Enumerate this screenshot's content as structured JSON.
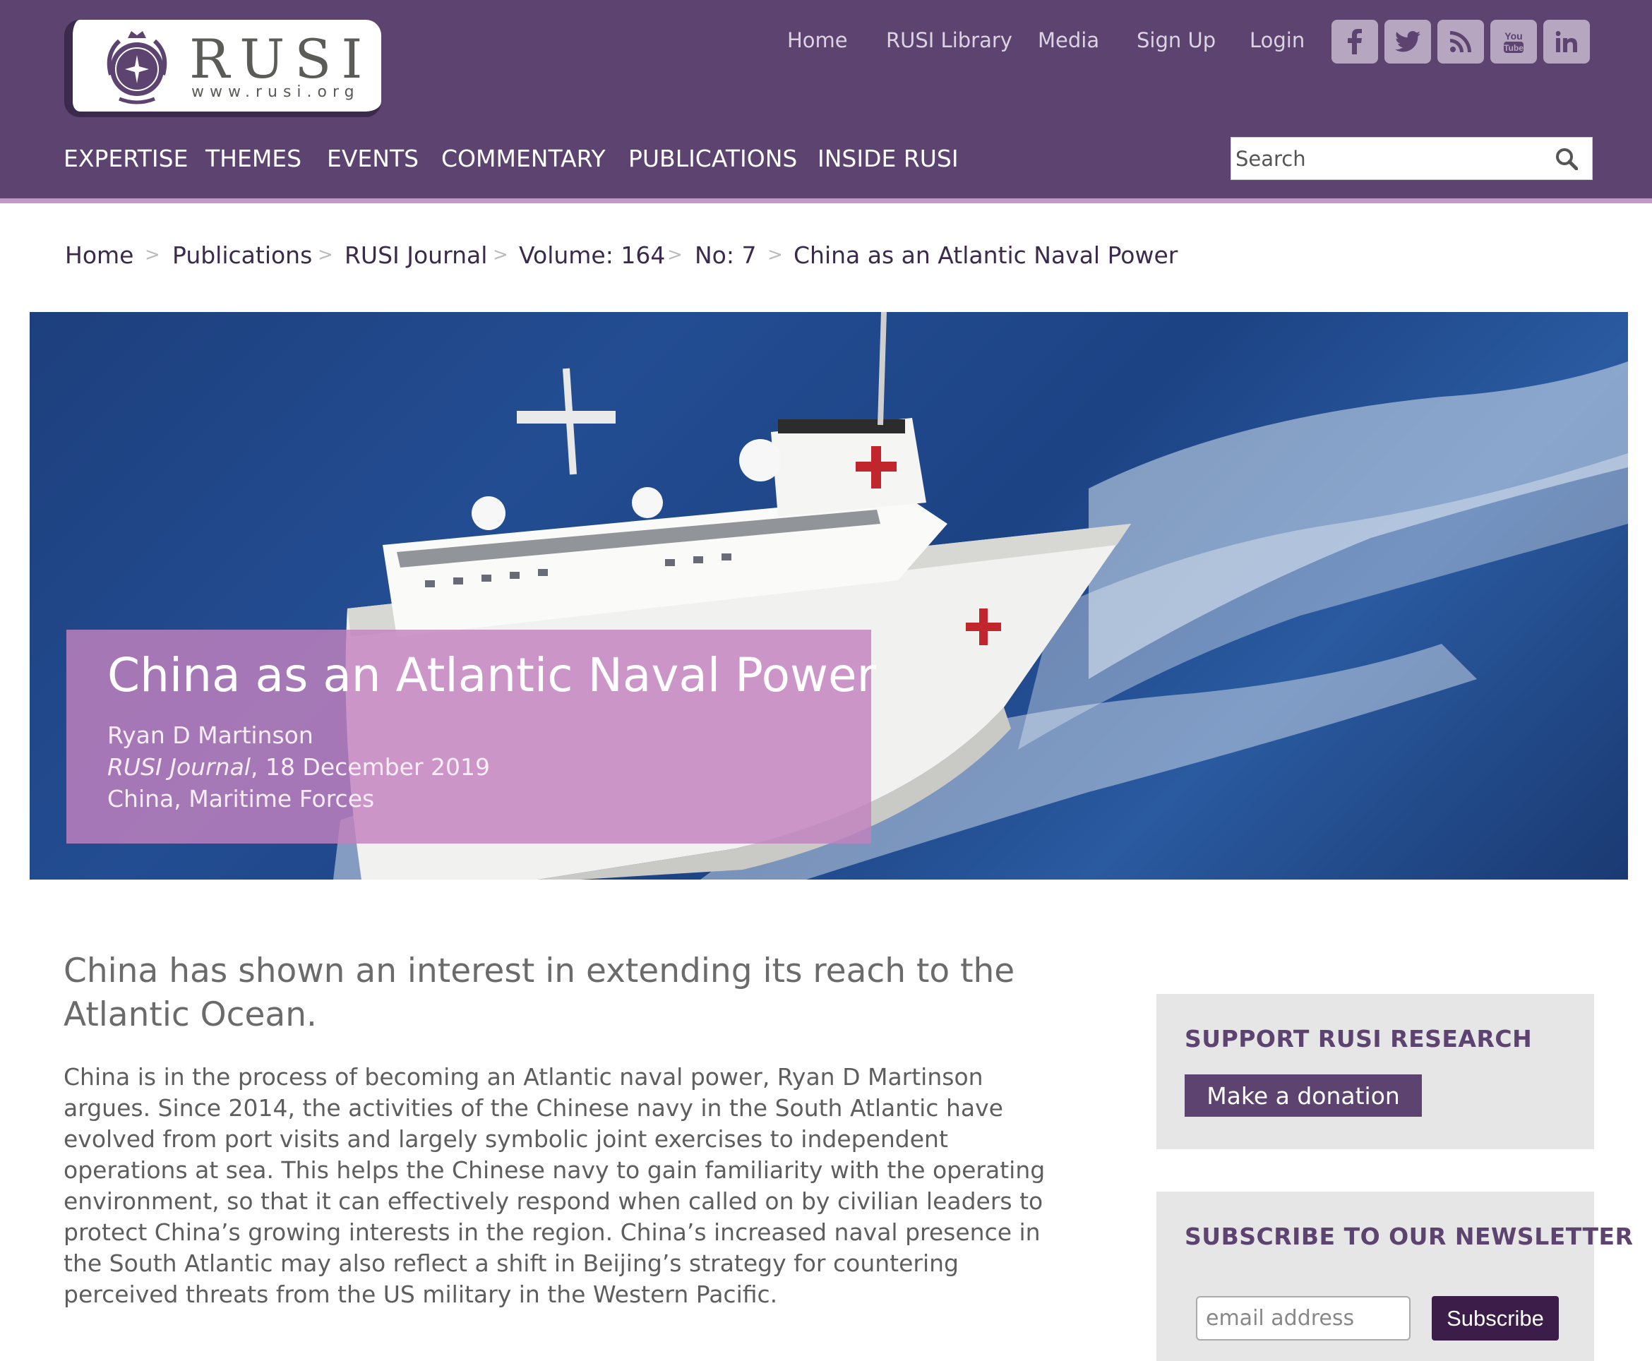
{
  "logo": {
    "name": "RUSI",
    "url": "www.rusi.org"
  },
  "topnav": [
    "Home",
    "RUSI Library",
    "Media",
    "Sign Up",
    "Login"
  ],
  "social": [
    "facebook-icon",
    "twitter-icon",
    "rss-icon",
    "youtube-icon",
    "linkedin-icon"
  ],
  "mainnav": [
    "EXPERTISE",
    "THEMES",
    "EVENTS",
    "COMMENTARY",
    "PUBLICATIONS",
    "INSIDE RUSI"
  ],
  "search": {
    "placeholder": "Search"
  },
  "breadcrumb": [
    "Home",
    "Publications",
    "RUSI Journal",
    "Volume: 164",
    "No: 7",
    "China as an Atlantic Naval Power"
  ],
  "article": {
    "title": "China as an Atlantic Naval Power",
    "author": "Ryan D Martinson",
    "journal": "RUSI Journal",
    "date": ", 18 December 2019",
    "tags": "China, Maritime Forces",
    "lead": "China has shown an interest in extending its reach to the Atlantic Ocean.",
    "body": "China is in the process of becoming an Atlantic naval power, Ryan D Martinson argues. Since 2014, the activities of the Chinese navy in the South Atlantic have evolved from port visits and largely symbolic joint exercises to independent operations at sea. This helps the Chinese navy to gain familiarity with the operating environment, so that it can effectively respond when called on by civilian leaders to protect China’s growing interests in the region. China’s increased naval presence in the South Atlantic may also reflect a shift in Beijing’s strategy for countering perceived threats from the US military in the Western Pacific."
  },
  "sidebar": {
    "support_heading": "SUPPORT RUSI RESEARCH",
    "donate_label": "Make a donation",
    "newsletter_heading": "SUBSCRIBE TO OUR NEWSLETTER",
    "email_placeholder": "email address",
    "subscribe_label": "Subscribe"
  },
  "colors": {
    "brand": "#5d4470",
    "accent": "#c497c9",
    "card": "#c281be"
  }
}
